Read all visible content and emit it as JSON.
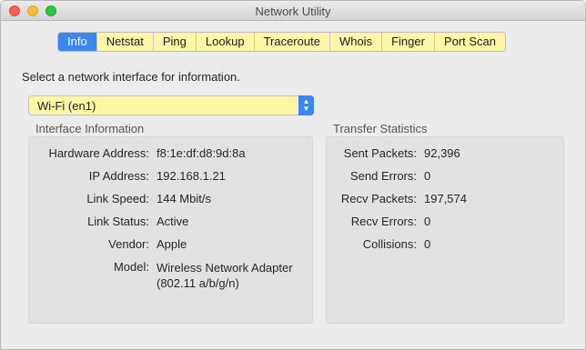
{
  "window": {
    "title": "Network Utility"
  },
  "tabs": [
    {
      "label": "Info",
      "active": true
    },
    {
      "label": "Netstat",
      "active": false
    },
    {
      "label": "Ping",
      "active": false
    },
    {
      "label": "Lookup",
      "active": false
    },
    {
      "label": "Traceroute",
      "active": false
    },
    {
      "label": "Whois",
      "active": false
    },
    {
      "label": "Finger",
      "active": false
    },
    {
      "label": "Port Scan",
      "active": false
    }
  ],
  "info": {
    "prompt": "Select a network interface for information.",
    "interface_select": {
      "value": "Wi-Fi (en1)"
    },
    "interface_information": {
      "title": "Interface Information",
      "rows": [
        {
          "label": "Hardware Address:",
          "value": "f8:1e:df:d8:9d:8a"
        },
        {
          "label": "IP Address:",
          "value": "192.168.1.21"
        },
        {
          "label": "Link Speed:",
          "value": "144 Mbit/s"
        },
        {
          "label": "Link Status:",
          "value": "Active"
        },
        {
          "label": "Vendor:",
          "value": "Apple"
        },
        {
          "label": "Model:",
          "value": "Wireless Network Adapter (802.11 a/b/g/n)"
        }
      ]
    },
    "transfer_statistics": {
      "title": "Transfer Statistics",
      "rows": [
        {
          "label": "Sent Packets:",
          "value": "92,396"
        },
        {
          "label": "Send Errors:",
          "value": "0"
        },
        {
          "label": "Recv Packets:",
          "value": "197,574"
        },
        {
          "label": "Recv Errors:",
          "value": "0"
        },
        {
          "label": "Collisions:",
          "value": "0"
        }
      ]
    }
  },
  "colors": {
    "accent": "#3b86ef",
    "highlight_field": "#fbf7a6",
    "close": "#fd5f57",
    "minimize": "#febc2e",
    "zoom": "#28c840"
  }
}
